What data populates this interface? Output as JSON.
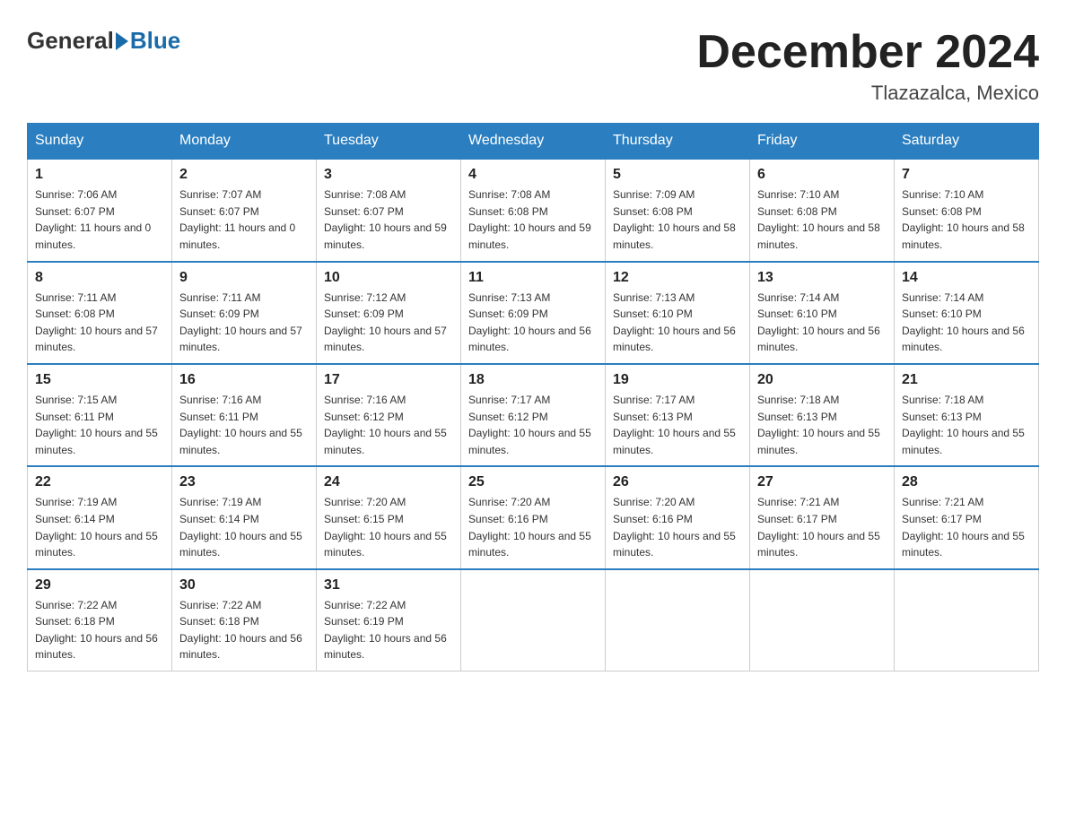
{
  "header": {
    "logo_general": "General",
    "logo_blue": "Blue",
    "month_title": "December 2024",
    "location": "Tlazazalca, Mexico"
  },
  "days_of_week": [
    "Sunday",
    "Monday",
    "Tuesday",
    "Wednesday",
    "Thursday",
    "Friday",
    "Saturday"
  ],
  "weeks": [
    [
      {
        "day": "1",
        "sunrise": "7:06 AM",
        "sunset": "6:07 PM",
        "daylight": "11 hours and 0 minutes."
      },
      {
        "day": "2",
        "sunrise": "7:07 AM",
        "sunset": "6:07 PM",
        "daylight": "11 hours and 0 minutes."
      },
      {
        "day": "3",
        "sunrise": "7:08 AM",
        "sunset": "6:07 PM",
        "daylight": "10 hours and 59 minutes."
      },
      {
        "day": "4",
        "sunrise": "7:08 AM",
        "sunset": "6:08 PM",
        "daylight": "10 hours and 59 minutes."
      },
      {
        "day": "5",
        "sunrise": "7:09 AM",
        "sunset": "6:08 PM",
        "daylight": "10 hours and 58 minutes."
      },
      {
        "day": "6",
        "sunrise": "7:10 AM",
        "sunset": "6:08 PM",
        "daylight": "10 hours and 58 minutes."
      },
      {
        "day": "7",
        "sunrise": "7:10 AM",
        "sunset": "6:08 PM",
        "daylight": "10 hours and 58 minutes."
      }
    ],
    [
      {
        "day": "8",
        "sunrise": "7:11 AM",
        "sunset": "6:08 PM",
        "daylight": "10 hours and 57 minutes."
      },
      {
        "day": "9",
        "sunrise": "7:11 AM",
        "sunset": "6:09 PM",
        "daylight": "10 hours and 57 minutes."
      },
      {
        "day": "10",
        "sunrise": "7:12 AM",
        "sunset": "6:09 PM",
        "daylight": "10 hours and 57 minutes."
      },
      {
        "day": "11",
        "sunrise": "7:13 AM",
        "sunset": "6:09 PM",
        "daylight": "10 hours and 56 minutes."
      },
      {
        "day": "12",
        "sunrise": "7:13 AM",
        "sunset": "6:10 PM",
        "daylight": "10 hours and 56 minutes."
      },
      {
        "day": "13",
        "sunrise": "7:14 AM",
        "sunset": "6:10 PM",
        "daylight": "10 hours and 56 minutes."
      },
      {
        "day": "14",
        "sunrise": "7:14 AM",
        "sunset": "6:10 PM",
        "daylight": "10 hours and 56 minutes."
      }
    ],
    [
      {
        "day": "15",
        "sunrise": "7:15 AM",
        "sunset": "6:11 PM",
        "daylight": "10 hours and 55 minutes."
      },
      {
        "day": "16",
        "sunrise": "7:16 AM",
        "sunset": "6:11 PM",
        "daylight": "10 hours and 55 minutes."
      },
      {
        "day": "17",
        "sunrise": "7:16 AM",
        "sunset": "6:12 PM",
        "daylight": "10 hours and 55 minutes."
      },
      {
        "day": "18",
        "sunrise": "7:17 AM",
        "sunset": "6:12 PM",
        "daylight": "10 hours and 55 minutes."
      },
      {
        "day": "19",
        "sunrise": "7:17 AM",
        "sunset": "6:13 PM",
        "daylight": "10 hours and 55 minutes."
      },
      {
        "day": "20",
        "sunrise": "7:18 AM",
        "sunset": "6:13 PM",
        "daylight": "10 hours and 55 minutes."
      },
      {
        "day": "21",
        "sunrise": "7:18 AM",
        "sunset": "6:13 PM",
        "daylight": "10 hours and 55 minutes."
      }
    ],
    [
      {
        "day": "22",
        "sunrise": "7:19 AM",
        "sunset": "6:14 PM",
        "daylight": "10 hours and 55 minutes."
      },
      {
        "day": "23",
        "sunrise": "7:19 AM",
        "sunset": "6:14 PM",
        "daylight": "10 hours and 55 minutes."
      },
      {
        "day": "24",
        "sunrise": "7:20 AM",
        "sunset": "6:15 PM",
        "daylight": "10 hours and 55 minutes."
      },
      {
        "day": "25",
        "sunrise": "7:20 AM",
        "sunset": "6:16 PM",
        "daylight": "10 hours and 55 minutes."
      },
      {
        "day": "26",
        "sunrise": "7:20 AM",
        "sunset": "6:16 PM",
        "daylight": "10 hours and 55 minutes."
      },
      {
        "day": "27",
        "sunrise": "7:21 AM",
        "sunset": "6:17 PM",
        "daylight": "10 hours and 55 minutes."
      },
      {
        "day": "28",
        "sunrise": "7:21 AM",
        "sunset": "6:17 PM",
        "daylight": "10 hours and 55 minutes."
      }
    ],
    [
      {
        "day": "29",
        "sunrise": "7:22 AM",
        "sunset": "6:18 PM",
        "daylight": "10 hours and 56 minutes."
      },
      {
        "day": "30",
        "sunrise": "7:22 AM",
        "sunset": "6:18 PM",
        "daylight": "10 hours and 56 minutes."
      },
      {
        "day": "31",
        "sunrise": "7:22 AM",
        "sunset": "6:19 PM",
        "daylight": "10 hours and 56 minutes."
      },
      null,
      null,
      null,
      null
    ]
  ]
}
